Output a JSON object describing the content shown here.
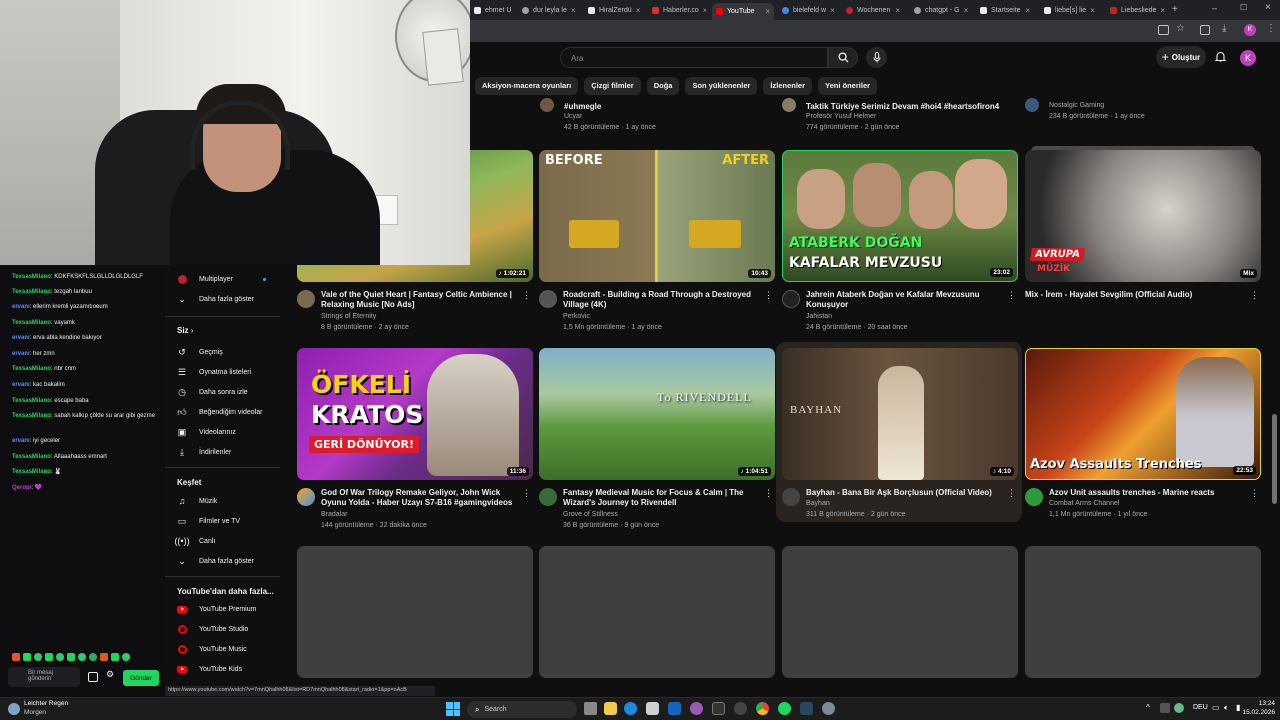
{
  "browser": {
    "tabs": [
      {
        "label": "ehmet U",
        "color": "#e8eaed",
        "active": false
      },
      {
        "label": "dur leyla le",
        "color": "#9aa0a6",
        "active": false
      },
      {
        "label": "HiralZerdü",
        "color": "#e8eaed",
        "active": false
      },
      {
        "label": "Haberler.co",
        "color": "#d93025",
        "active": false
      },
      {
        "label": "YouTube",
        "color": "#ff0000",
        "active": true
      },
      {
        "label": "bielefeld w",
        "color": "#4285f4",
        "active": false
      },
      {
        "label": "Wochenen",
        "color": "#c5221f",
        "active": false
      },
      {
        "label": "chatgpt - G",
        "color": "#9aa0a6",
        "active": false
      },
      {
        "label": "Startseite",
        "color": "#e8eaed",
        "active": false
      },
      {
        "label": "liebe[s] lie",
        "color": "#e8eaed",
        "active": false
      },
      {
        "label": "Liebesliede",
        "color": "#c5221f",
        "active": false
      }
    ],
    "status_url": "https://www.youtube.com/watch?v=7mnQhalhh08&list=RD7mnQhalhh08&start_radio=1&pp=oAcB"
  },
  "youtube": {
    "search_placeholder": "Ara",
    "create_label": "Oluştur",
    "avatar_letter": "K",
    "chips": [
      "Aksiyon-macera oyunları",
      "Çizgi filmler",
      "Doğa",
      "Son yüklenenler",
      "İzlenenler",
      "Yeni öneriler"
    ],
    "sidebar": {
      "top_items": [
        {
          "label": "Multiplayer",
          "icon": "multiplayer-icon"
        },
        {
          "label": "Daha fazla göster",
          "icon": "chevron-down-icon"
        }
      ],
      "you_heading": "Siz",
      "you_items": [
        {
          "label": "Geçmiş",
          "icon": "history-icon"
        },
        {
          "label": "Oynatma listeleri",
          "icon": "playlist-icon"
        },
        {
          "label": "Daha sonra izle",
          "icon": "clock-icon"
        },
        {
          "label": "Beğendiğim videolar",
          "icon": "thumbs-up-icon"
        },
        {
          "label": "Videolarınız",
          "icon": "your-videos-icon"
        },
        {
          "label": "İndirilenler",
          "icon": "download-icon"
        }
      ],
      "explore_heading": "Keşfet",
      "explore_items": [
        {
          "label": "Müzik",
          "icon": "music-icon"
        },
        {
          "label": "Filmler ve TV",
          "icon": "film-icon"
        },
        {
          "label": "Canlı",
          "icon": "live-icon"
        },
        {
          "label": "Daha fazla göster",
          "icon": "chevron-down-icon"
        }
      ],
      "more_heading": "YouTube'dan daha fazla...",
      "more_items": [
        {
          "label": "YouTube Premium",
          "icon": "youtube-premium-icon"
        },
        {
          "label": "YouTube Studio",
          "icon": "youtube-studio-icon"
        },
        {
          "label": "YouTube Music",
          "icon": "youtube-music-icon"
        },
        {
          "label": "YouTube Kids",
          "icon": "youtube-kids-icon"
        }
      ]
    },
    "partial_row": [
      {
        "title": "#uhmegle",
        "channel": "Ucyar",
        "stats": "42 B görüntüleme · 1 ay önce"
      },
      {
        "title": "Taktik Türkiye Serimiz Devam #hoi4 #heartsofiron4",
        "channel": "Profesör Yusuf Helmer",
        "stats": "774 görüntüleme · 2 gün önce"
      },
      {
        "title": "",
        "channel": "Nostalgic Gaming",
        "stats": "234 B görüntüleme · 1 ay önce"
      }
    ],
    "row1": [
      {
        "title": "Vale of the Quiet Heart | Fantasy Celtic Ambience | Relaxing Music [No Ads]",
        "channel": "Strings of Eternity",
        "stats": "8 B görüntüleme · 2 ay önce",
        "duration": "♪ 1:02:21"
      },
      {
        "title": "Roadcraft - Building a Road Through a Destroyed Village (4K)",
        "channel": "Perkovic",
        "stats": "1,5 Mn görüntüleme · 1 ay önce",
        "duration": "10:43",
        "thumb_left": "BEFORE",
        "thumb_right": "AFTER"
      },
      {
        "title": "Jahrein Ataberk Doğan ve Kafalar Mevzusunu Konuşuyor",
        "channel": "Jahistan",
        "stats": "24 B görüntüleme · 20 saat önce",
        "duration": "23:02",
        "thumb_text1": "ATABERK DOĞAN",
        "thumb_text2": "KAFALAR MEVZUSU"
      },
      {
        "title": "Mix - İrem - Hayalet Sevgilim (Official Audio)",
        "channel": "",
        "stats": "",
        "duration": "Mix",
        "thumb_text1": "AVRUPA",
        "thumb_text2": "MÜZİK"
      }
    ],
    "row2": [
      {
        "title": "God Of War Trilogy Remake Geliyor, John Wick Oyunu Yolda - Haber Uzayı S7-B16 #gamingvideos",
        "channel": "Bradalar",
        "stats": "144 görüntüleme · 22 dakika önce",
        "duration": "11:36",
        "thumb_text1": "ÖFKELİ",
        "thumb_text2": "KRATOS",
        "thumb_text3": "GERİ DÖNÜYOR!"
      },
      {
        "title": "Fantasy Medieval Music for Focus & Calm | The Wizard's Journey to Rivendell",
        "channel": "Grove of Stillness",
        "stats": "36 B görüntüleme · 9 gün önce",
        "duration": "♪ 1:04:51",
        "thumb_text1": "To RIVENDELL"
      },
      {
        "title": "Bayhan - Bana Bir Aşk Borçlusun (Official Video)",
        "channel": "Bayhan",
        "stats": "311 B görüntüleme · 2 gün önce",
        "duration": "♪ 4:10",
        "thumb_text1": "BAYHAN"
      },
      {
        "title": "Azov Unit assaults trenches - Marine reacts",
        "channel": "Combat Arms Channel",
        "stats": "1,1 Mn görüntüleme · 1 yıl önce",
        "duration": "22:53",
        "thumb_text1": "Azov Assaults Trenches"
      }
    ]
  },
  "chat": {
    "messages": [
      {
        "user": "TexsasMilano",
        "text": "KDKFKSKFLSLGLLDLGLDLGLF",
        "color": "#1ed760"
      },
      {
        "user": "TexsasMilano",
        "text": "tezgah lanbuu",
        "color": "#1ed760"
      },
      {
        "user": "ervanı",
        "text": "ellerim kremli yazamıtıoeum",
        "color": "#5c8dff"
      },
      {
        "user": "TexsasMilano",
        "text": "vayamk",
        "color": "#1ed760"
      },
      {
        "user": "ervanı",
        "text": "erva abla kendine bakıyor",
        "color": "#5c8dff"
      },
      {
        "user": "ervanı",
        "text": "her zmn",
        "color": "#5c8dff"
      },
      {
        "user": "TexsasMilano",
        "text": "nbr cnm",
        "color": "#1ed760"
      },
      {
        "user": "ervanı",
        "text": "kac bakalim",
        "color": "#5c8dff"
      },
      {
        "user": "TexsasMilano",
        "text": "escape baba",
        "color": "#1ed760"
      },
      {
        "user": "TexsasMilano",
        "text": "sabah kalkıp çölde su arar gibi gezme",
        "color": "#1ed760"
      },
      {
        "user": "ervanı",
        "text": "iyi geceler",
        "color": "#5c8dff"
      },
      {
        "user": "TexsasMilano",
        "text": "Allaaahaass emnart",
        "color": "#1ed760"
      },
      {
        "user": "TexsasMilano",
        "text": "🐰",
        "color": "#1ed760"
      },
      {
        "user": "Qeropı",
        "text": "💜",
        "color": "#c13fbf"
      }
    ],
    "input_placeholder": "Bir mesaj gönderin",
    "send_label": "Gönder"
  },
  "taskbar": {
    "weather_title": "Leichter Regen",
    "weather_sub": "Morgen",
    "search_label": "Search",
    "lang": "DEU",
    "time": "13:24",
    "date": "15.02.2026"
  }
}
